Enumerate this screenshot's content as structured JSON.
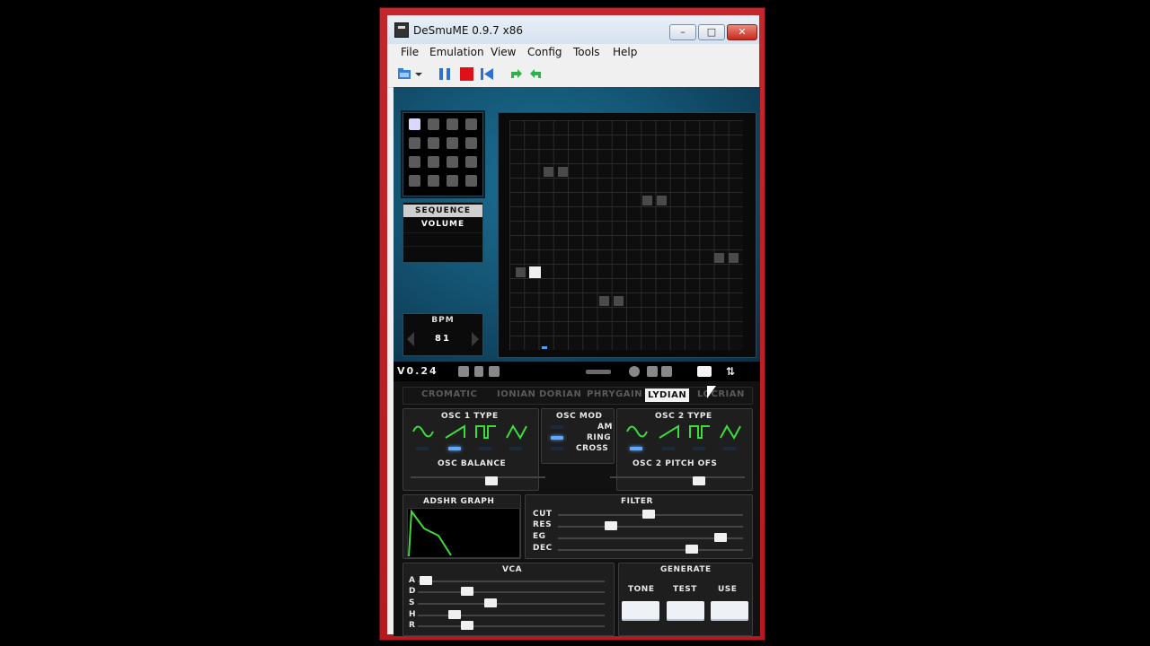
{
  "window": {
    "title": "DeSmuME 0.9.7 x86",
    "min": "–",
    "max": "□",
    "close": "✕"
  },
  "menu": [
    "File",
    "Emulation",
    "View",
    "Config",
    "Tools",
    "Help"
  ],
  "sequencer": {
    "modes": [
      "SEQUENCE",
      "VOLUME"
    ],
    "active_mode": "SEQUENCE",
    "bpm_label": "BPM",
    "bpm_value": "81"
  },
  "status": {
    "version": "V0.24"
  },
  "scales": [
    "CROMATIC",
    "IONIAN",
    "DORIAN",
    "PHRYGAIN",
    "LYDIAN",
    "LOCRIAN"
  ],
  "active_scale": "LYDIAN",
  "osc": {
    "osc1_label": "OSC 1 TYPE",
    "osc2_label": "OSC 2 TYPE",
    "mod_label": "OSC MOD",
    "mod_options": [
      "AM",
      "RING",
      "CROSS"
    ],
    "balance_label": "OSC BALANCE",
    "pitch_label": "OSC 2 PITCH OFS"
  },
  "adshr": {
    "label": "ADSHR GRAPH"
  },
  "filter": {
    "label": "FILTER",
    "params": [
      "CUT",
      "RES",
      "EG",
      "DEC"
    ]
  },
  "vca": {
    "label": "VCA",
    "params": [
      "A",
      "D",
      "S",
      "H",
      "R"
    ]
  },
  "generate": {
    "label": "GENERATE",
    "buttons": [
      "TONE",
      "TEST",
      "USE"
    ]
  },
  "colors": {
    "accent_green": "#3ddc3d",
    "led_blue": "#5fa8ff",
    "window_red": "#c2272d"
  }
}
